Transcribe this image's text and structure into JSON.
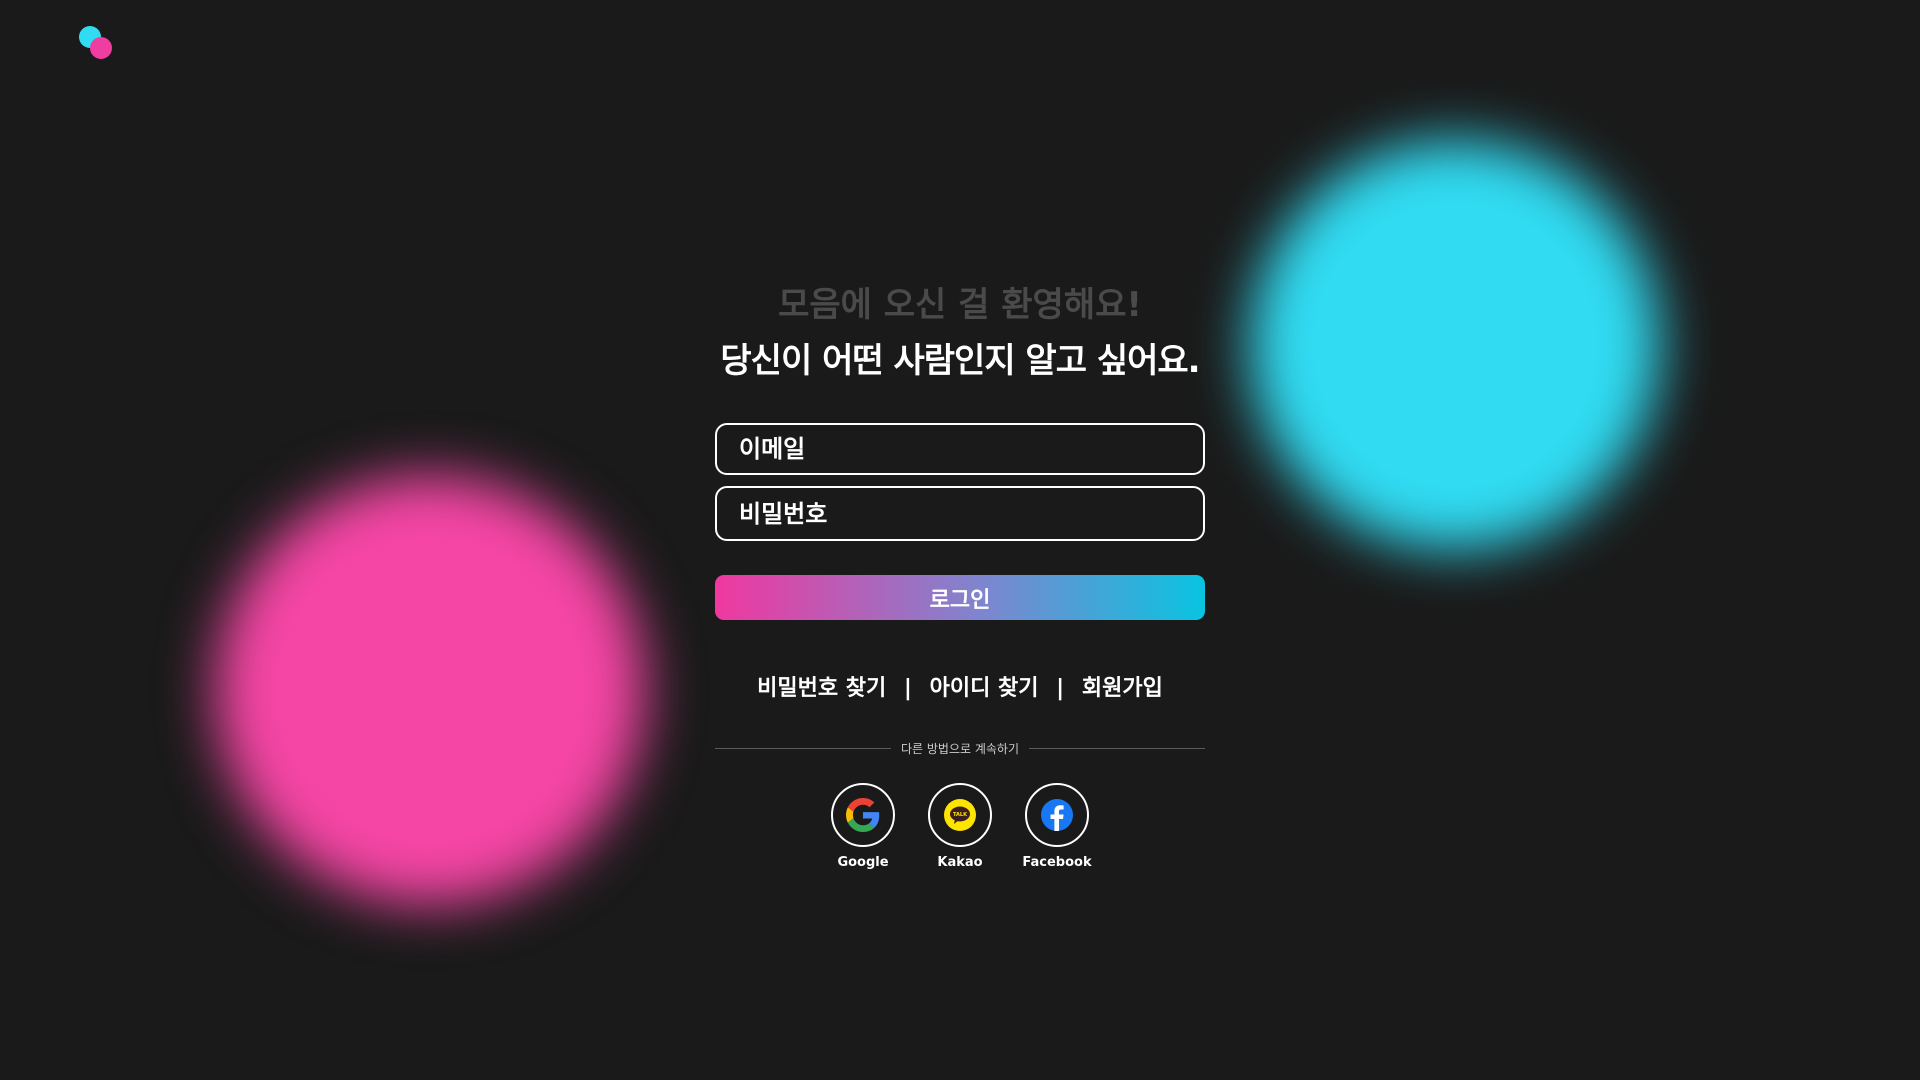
{
  "app": {
    "brand_colors": {
      "pink": "#f03da0",
      "cyan": "#31dcf3",
      "background": "#1a1a1a"
    },
    "logo_icon": "two-overlapping-dots-logo"
  },
  "header": {
    "subtitle": "모음에 오신 걸 환영해요!",
    "title": "당신이 어떤 사람인지 알고 싶어요."
  },
  "form": {
    "email_placeholder": "이메일",
    "password_placeholder": "비밀번호",
    "login_label": "로그인",
    "login_gradient": [
      "#f0389f",
      "#09c4e0"
    ]
  },
  "links": {
    "find_password": "비밀번호 찾기",
    "separator": "|",
    "find_id": "아이디 찾기",
    "signup": "회원가입"
  },
  "divider": {
    "label": "다른 방법으로 계속하기"
  },
  "socials": [
    {
      "name": "Google",
      "icon": "google-icon"
    },
    {
      "name": "Kakao",
      "icon": "kakao-talk-icon"
    },
    {
      "name": "Facebook",
      "icon": "facebook-icon"
    }
  ]
}
